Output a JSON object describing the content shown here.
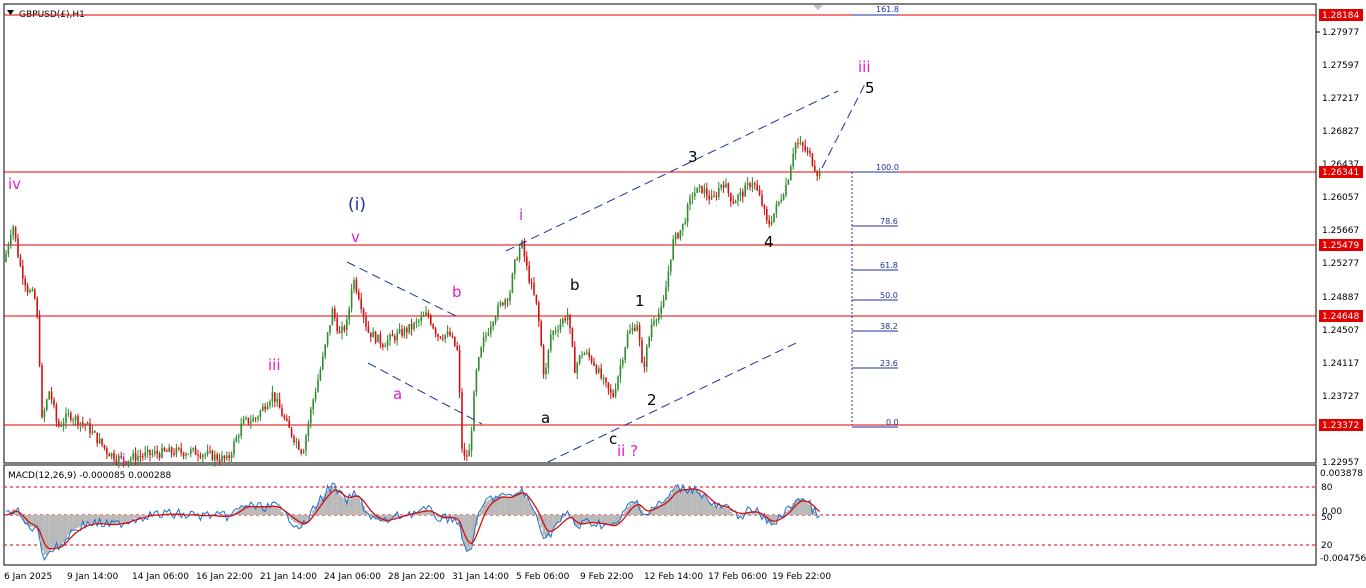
{
  "window": {
    "title": "GBPUSD(£),H1",
    "menu_icon": "triangle-down-icon"
  },
  "colors": {
    "bull": "#2e8b2e",
    "bear": "#d11010",
    "hline": "#e00000",
    "trend": "#1f2f9f",
    "fib": "#1f2f9f",
    "macd_hist": "#b8b8b8",
    "macd_main": "#1f6fcf",
    "macd_signal": "#d01010",
    "pink": "#e020d0"
  },
  "price_axis": {
    "ticks": [
      "1.27977",
      "1.27597",
      "1.27217",
      "1.26827",
      "1.26437",
      "1.26057",
      "1.25667",
      "1.25277",
      "1.24887",
      "1.24507",
      "1.24117",
      "1.23727",
      "1.22957"
    ],
    "level_labels": [
      "1.28184",
      "1.26341",
      "1.25479",
      "1.24648",
      "1.23372"
    ]
  },
  "time_axis": {
    "ticks": [
      "6 Jan 2025",
      "9 Jan 14:00",
      "14 Jan 06:00",
      "16 Jan 22:00",
      "21 Jan 14:00",
      "24 Jan 06:00",
      "28 Jan 22:00",
      "31 Jan 14:00",
      "5 Feb 06:00",
      "9 Feb 22:00",
      "12 Feb 14:00",
      "17 Feb 06:00",
      "19 Feb 22:00"
    ]
  },
  "fib_levels": [
    "161.8",
    "100.0",
    "78.6",
    "61.8",
    "50.0",
    "38.2",
    "23.6",
    "0.0"
  ],
  "wave_labels": {
    "iv": "iv",
    "i_left": "i",
    "iii_left": "iii",
    "v": "v",
    "wave_i_paren": "(i)",
    "a_pink": "a",
    "b_pink": "b",
    "i_pink": "i",
    "b_black": "b",
    "a_black": "a",
    "c_black": "c",
    "ii_q": "ii ?",
    "w1": "1",
    "w2": "2",
    "w3": "3",
    "w4": "4",
    "w5": "5",
    "iii_right": "iii"
  },
  "macd": {
    "title": "MACD(12,26,9) -0.000085 0.000288",
    "scale_ticks": [
      "0.003878",
      "0.00",
      "-0.004756"
    ],
    "level_ticks": [
      "80",
      "50",
      "20"
    ]
  },
  "chart_data": {
    "type": "candlestick",
    "symbol": "GBPUSD",
    "timeframe": "H1",
    "ylim": [
      1.2288,
      1.2835
    ],
    "horizontal_levels": [
      1.28184,
      1.26341,
      1.25479,
      1.24648,
      1.23372
    ],
    "fibonacci": {
      "from": 1.23372,
      "to": 1.26341,
      "levels": [
        {
          "pct": 161.8
        },
        {
          "pct": 100.0
        },
        {
          "pct": 78.6
        },
        {
          "pct": 61.8
        },
        {
          "pct": 50.0
        },
        {
          "pct": 38.2
        },
        {
          "pct": 23.6
        },
        {
          "pct": 0.0
        }
      ]
    },
    "price_path": [
      [
        0,
        1.2505
      ],
      [
        8,
        1.2535
      ],
      [
        15,
        1.2575
      ],
      [
        22,
        1.2525
      ],
      [
        30,
        1.2495
      ],
      [
        37,
        1.2485
      ],
      [
        41,
        1.2445
      ],
      [
        44,
        1.2335
      ],
      [
        52,
        1.2375
      ],
      [
        60,
        1.233
      ],
      [
        72,
        1.2345
      ],
      [
        90,
        1.233
      ],
      [
        110,
        1.23
      ],
      [
        125,
        1.229
      ],
      [
        140,
        1.2295
      ],
      [
        170,
        1.23
      ],
      [
        200,
        1.23
      ],
      [
        230,
        1.229
      ],
      [
        245,
        1.2335
      ],
      [
        258,
        1.234
      ],
      [
        275,
        1.237
      ],
      [
        290,
        1.233
      ],
      [
        305,
        1.23
      ],
      [
        315,
        1.236
      ],
      [
        325,
        1.241
      ],
      [
        335,
        1.247
      ],
      [
        342,
        1.244
      ],
      [
        350,
        1.2455
      ],
      [
        355,
        1.251
      ],
      [
        362,
        1.2485
      ],
      [
        370,
        1.2445
      ],
      [
        385,
        1.243
      ],
      [
        400,
        1.244
      ],
      [
        415,
        1.245
      ],
      [
        430,
        1.2465
      ],
      [
        440,
        1.244
      ],
      [
        452,
        1.244
      ],
      [
        460,
        1.242
      ],
      [
        465,
        1.229
      ],
      [
        472,
        1.23
      ],
      [
        478,
        1.239
      ],
      [
        485,
        1.243
      ],
      [
        495,
        1.246
      ],
      [
        505,
        1.248
      ],
      [
        512,
        1.249
      ],
      [
        518,
        1.253
      ],
      [
        524,
        1.255
      ],
      [
        530,
        1.2515
      ],
      [
        540,
        1.247
      ],
      [
        547,
        1.2385
      ],
      [
        553,
        1.244
      ],
      [
        560,
        1.245
      ],
      [
        570,
        1.2465
      ],
      [
        577,
        1.24
      ],
      [
        585,
        1.242
      ],
      [
        595,
        1.241
      ],
      [
        605,
        1.2385
      ],
      [
        615,
        1.2365
      ],
      [
        622,
        1.24
      ],
      [
        630,
        1.244
      ],
      [
        640,
        1.2455
      ],
      [
        645,
        1.2395
      ],
      [
        655,
        1.246
      ],
      [
        665,
        1.247
      ],
      [
        675,
        1.255
      ],
      [
        685,
        1.257
      ],
      [
        695,
        1.261
      ],
      [
        705,
        1.2615
      ],
      [
        715,
        1.26
      ],
      [
        725,
        1.2625
      ],
      [
        735,
        1.26
      ],
      [
        745,
        1.261
      ],
      [
        755,
        1.2625
      ],
      [
        765,
        1.2595
      ],
      [
        770,
        1.257
      ],
      [
        780,
        1.2595
      ],
      [
        790,
        1.2625
      ],
      [
        797,
        1.267
      ],
      [
        805,
        1.2665
      ],
      [
        812,
        1.2655
      ],
      [
        820,
        1.2634
      ]
    ]
  }
}
